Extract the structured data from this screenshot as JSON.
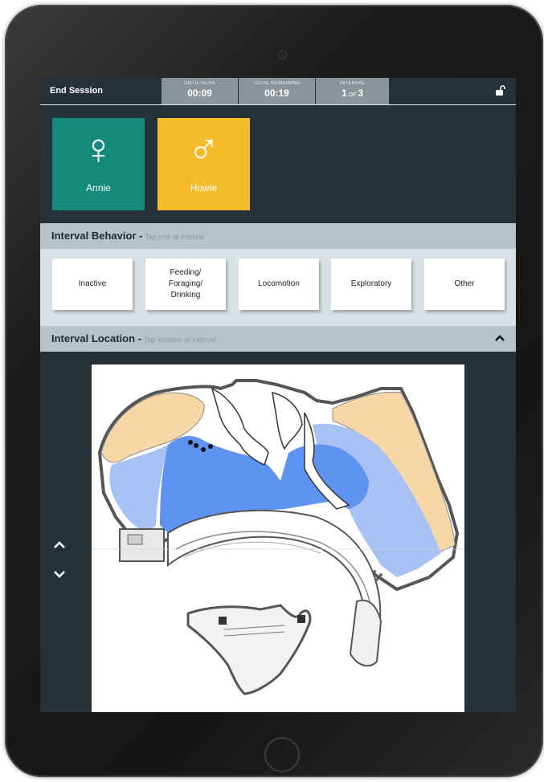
{
  "header": {
    "end_session": "End Session",
    "timers": [
      {
        "label": "UNTIL SCAN",
        "value": "00:09"
      },
      {
        "label": "TOTAL REMAINING",
        "value": "00:19"
      },
      {
        "label": "INTERVAL",
        "value_current": "1",
        "value_of": "OF",
        "value_total": "3"
      }
    ]
  },
  "animals": [
    {
      "name": "Annie",
      "symbol": "♀",
      "color": "#148a7c"
    },
    {
      "name": "Howie",
      "symbol": "♂",
      "color": "#f6bb2a"
    }
  ],
  "behavior": {
    "title": "Interval Behavior -",
    "hint": "Tap one at interval",
    "buttons": [
      "Inactive",
      "Feeding/\nForaging/\nDrinking",
      "Locomotion",
      "Exploratory",
      "Other"
    ]
  },
  "location": {
    "title": "Interval Location -",
    "hint": "Tap location at interval"
  },
  "colors": {
    "screen_bg": "#25323a",
    "section_bg": "#b5c4cb",
    "timer_bg": "#8a9599",
    "water_deep": "#5f93f2",
    "water_light": "#a8c1f4",
    "sand": "#f5d7a8"
  }
}
